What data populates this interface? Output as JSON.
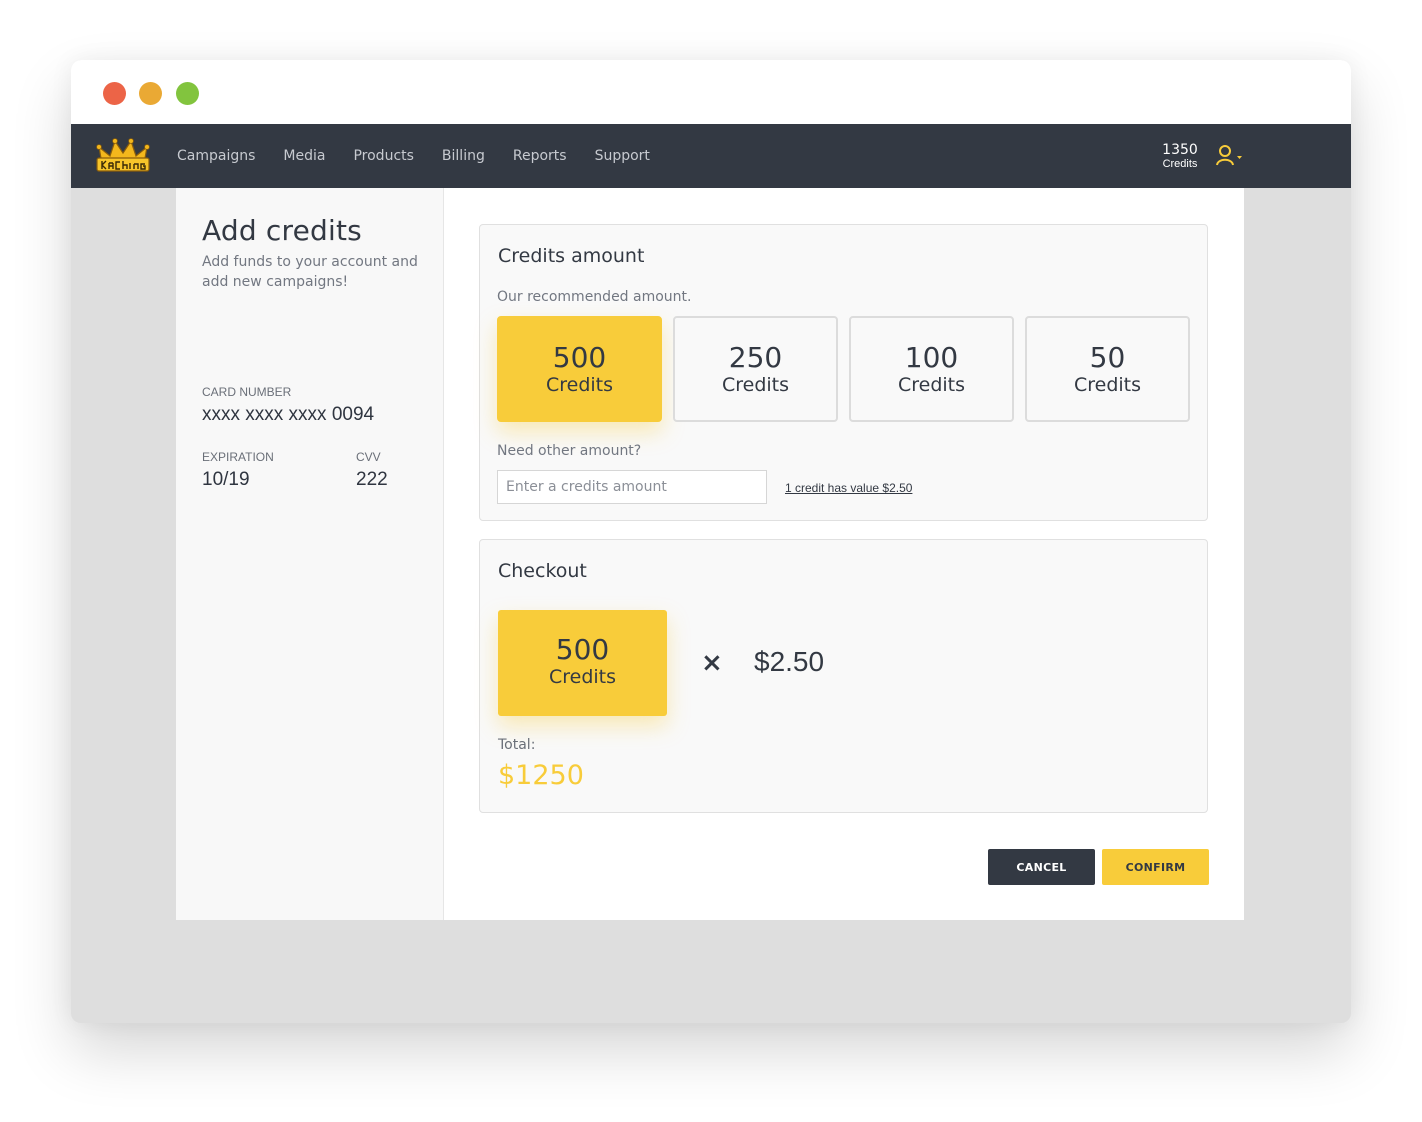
{
  "window": {
    "controls": [
      "close",
      "minimize",
      "maximize"
    ]
  },
  "header": {
    "logo_text": "KaChing",
    "nav": [
      "Campaigns",
      "Media",
      "Products",
      "Billing",
      "Reports",
      "Support"
    ],
    "credits_count": "1350",
    "credits_label": "Credits",
    "user_icon": "user-icon"
  },
  "sidebar": {
    "title": "Add credits",
    "subtitle": "Add funds to your account and add new campaigns!",
    "card_number_label": "CARD NUMBER",
    "card_number": "xxxx xxxx xxxx 0094",
    "expiration_label": "EXPIRATION",
    "expiration": "10/19",
    "cvv_label": "CVV",
    "cvv": "222"
  },
  "credits_panel": {
    "title": "Credits amount",
    "hint": "Our recommended amount.",
    "options": [
      {
        "amount": "500",
        "label": "Credits",
        "selected": true
      },
      {
        "amount": "250",
        "label": "Credits",
        "selected": false
      },
      {
        "amount": "100",
        "label": "Credits",
        "selected": false
      },
      {
        "amount": "50",
        "label": "Credits",
        "selected": false
      }
    ],
    "other_label": "Need other amount?",
    "input_placeholder": "Enter a credits amount",
    "input_value": "",
    "rate_link": "1 credit has value $2.50"
  },
  "checkout": {
    "title": "Checkout",
    "amount": "500",
    "amount_label": "Credits",
    "times": "×",
    "price": "$2.50",
    "total_label": "Total:",
    "total": "$1250"
  },
  "actions": {
    "cancel": "CANCEL",
    "confirm": "CONFIRM"
  },
  "colors": {
    "accent": "#f8cc3a",
    "dark": "#333943",
    "background": "#dedede"
  }
}
